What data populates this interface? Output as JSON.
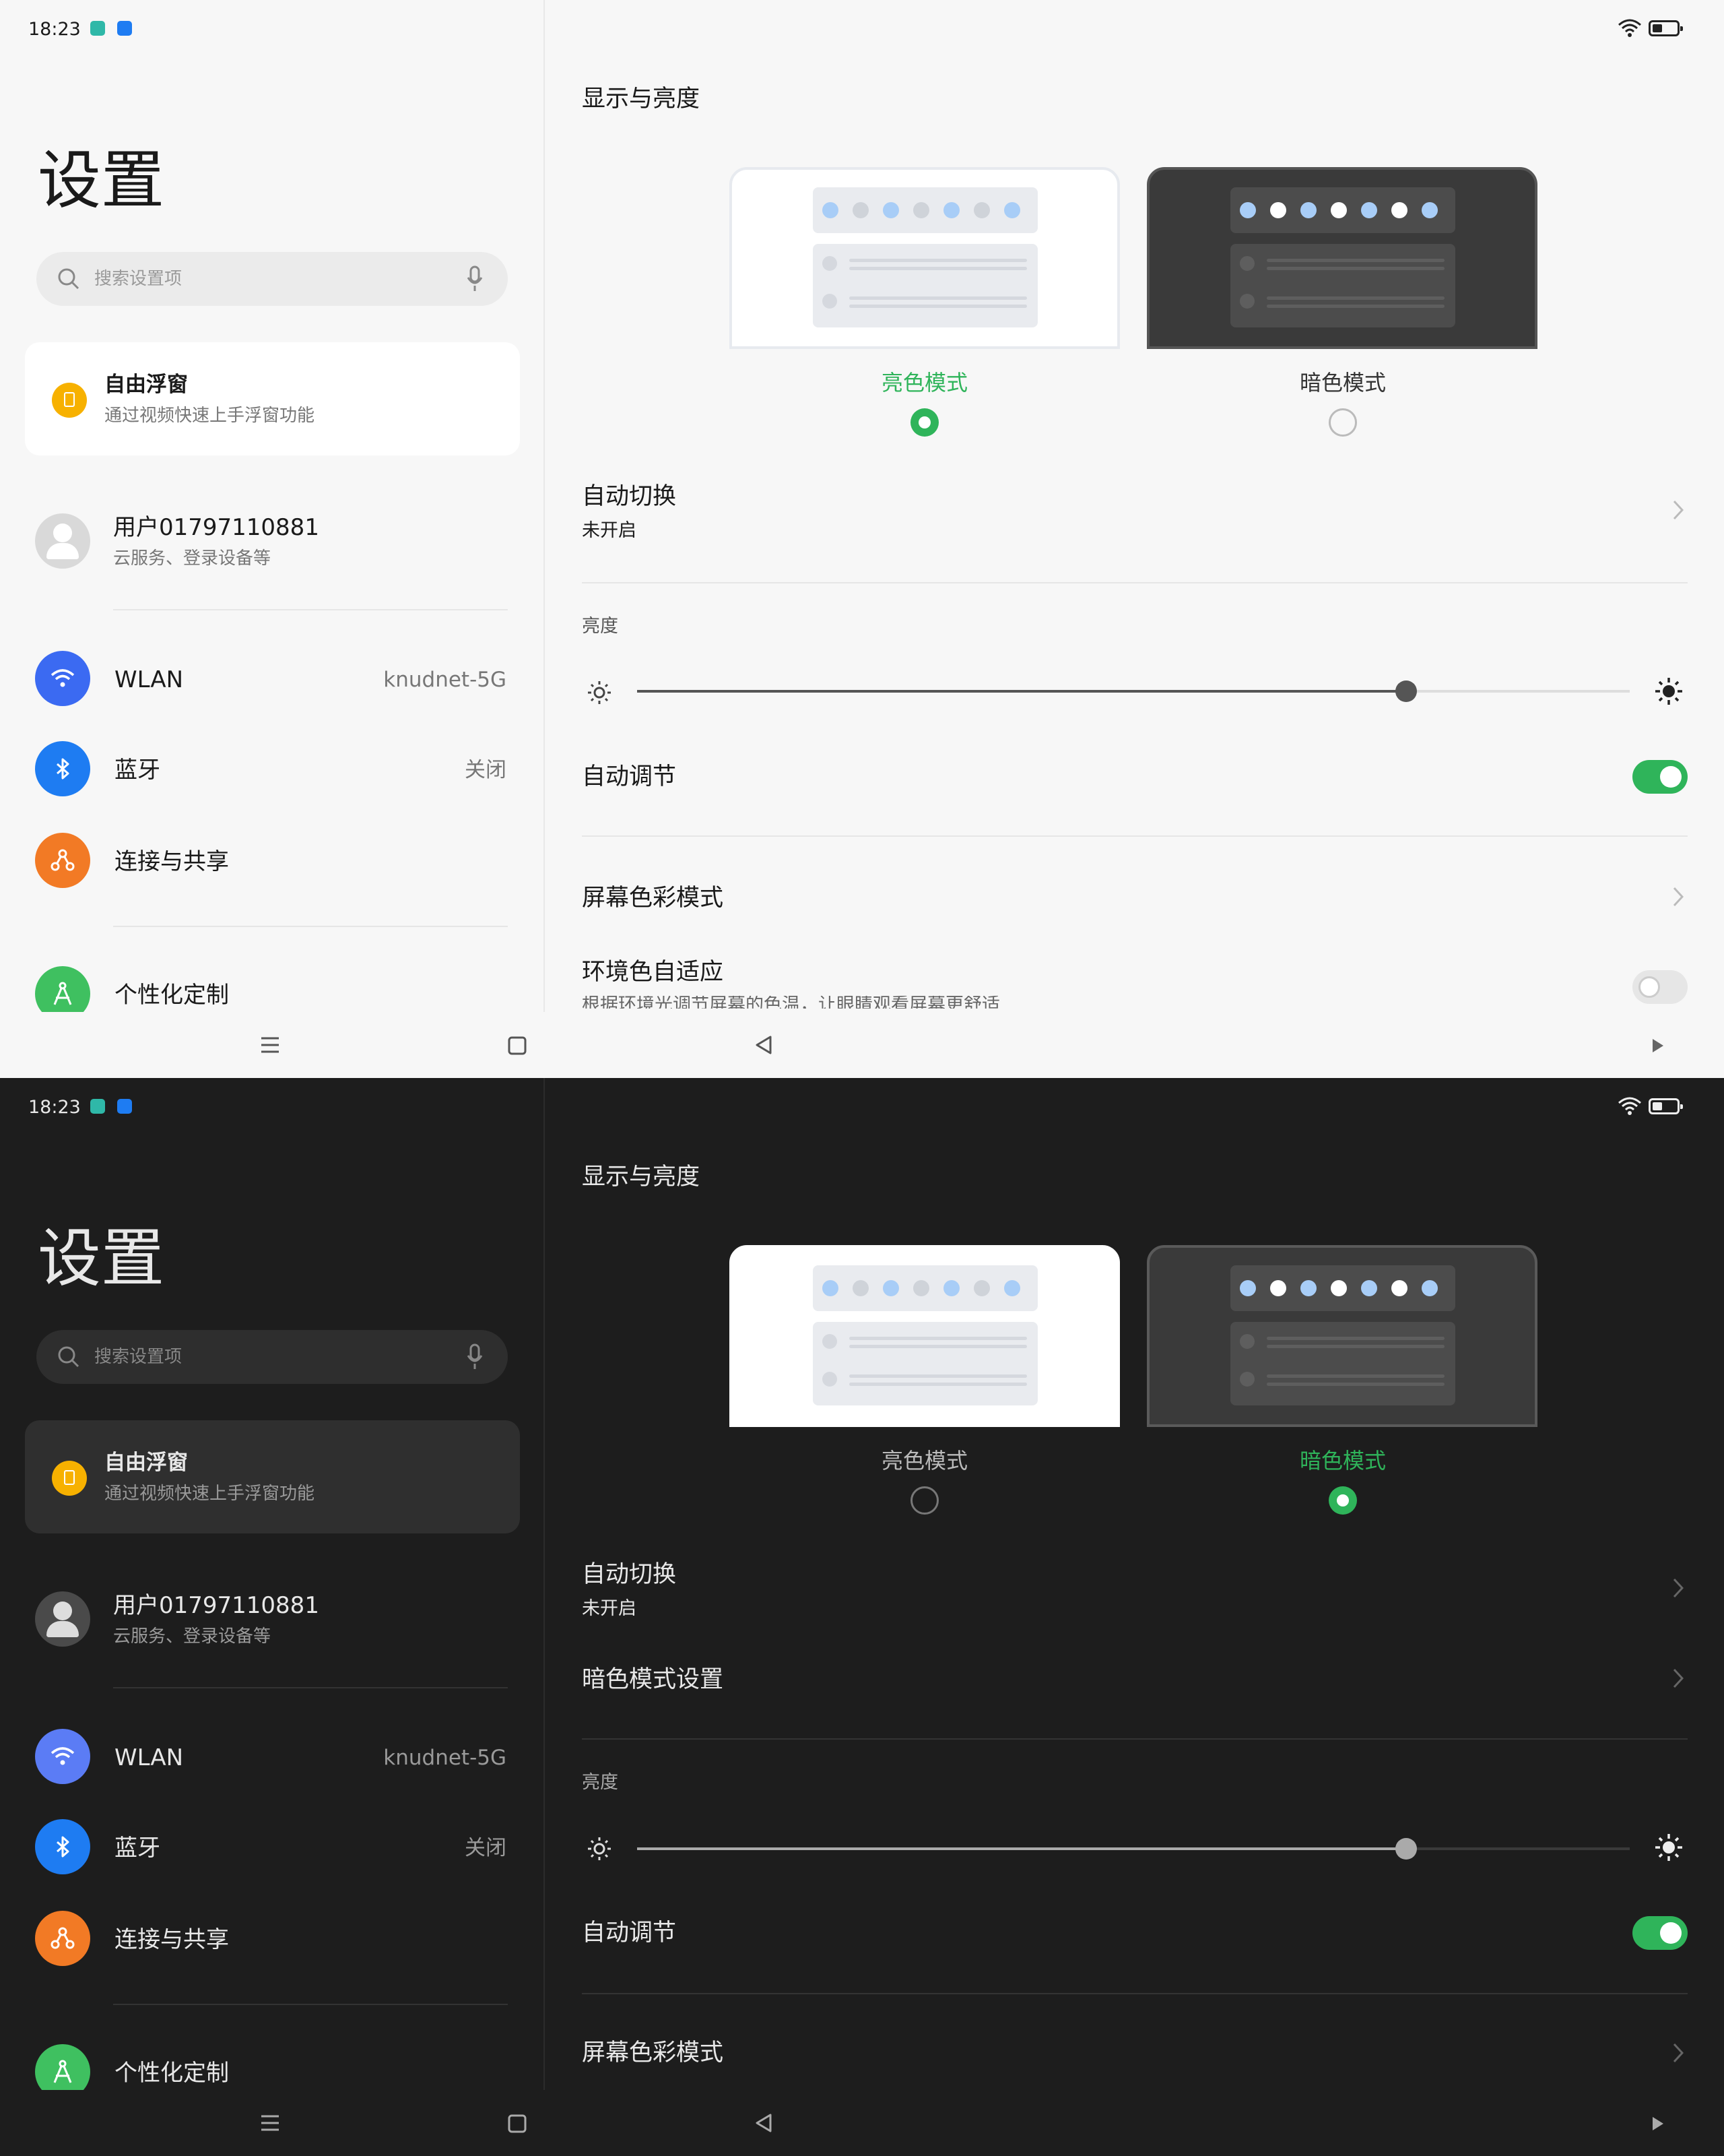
{
  "status_bar": {
    "time": "18:23"
  },
  "left": {
    "title": "设置",
    "search_placeholder": "搜索设置项",
    "float_card": {
      "title": "自由浮窗",
      "subtitle": "通过视频快速上手浮窗功能"
    },
    "account": {
      "name": "用户01797110881",
      "subtitle": "云服务、登录设备等"
    },
    "items": [
      {
        "label": "WLAN",
        "value": "knudnet-5G",
        "icon": "wifi-icon",
        "color": "#3b6af2"
      },
      {
        "label": "蓝牙",
        "value": "关闭",
        "icon": "bluetooth-icon",
        "color": "#1e7cf2"
      },
      {
        "label": "连接与共享",
        "value": "",
        "icon": "share-icon",
        "color": "#f27a25"
      },
      {
        "label": "个性化定制",
        "value": "",
        "icon": "personalize-icon",
        "color": "#3fc060"
      }
    ]
  },
  "right": {
    "title": "显示与亮度",
    "light_mode": "亮色模式",
    "dark_mode": "暗色模式",
    "auto_switch": {
      "label": "自动切换",
      "status": "未开启"
    },
    "dark_settings": "暗色模式设置",
    "brightness_label": "亮度",
    "brightness_level": 0.775,
    "auto_adjust": {
      "label": "自动调节",
      "enabled": true
    },
    "color_mode": "屏幕色彩模式",
    "ambient": {
      "label": "环境色自适应",
      "subtitle": "根据环境光调节屏幕的色温，让眼睛观看屏幕更舒适",
      "enabled": false
    }
  },
  "screens": [
    {
      "theme": "light",
      "selected_mode": "light"
    },
    {
      "theme": "dark",
      "selected_mode": "dark"
    }
  ],
  "colors": {
    "accent": "#2fb45a",
    "preview_dot_blue": "#a8cdf7"
  }
}
